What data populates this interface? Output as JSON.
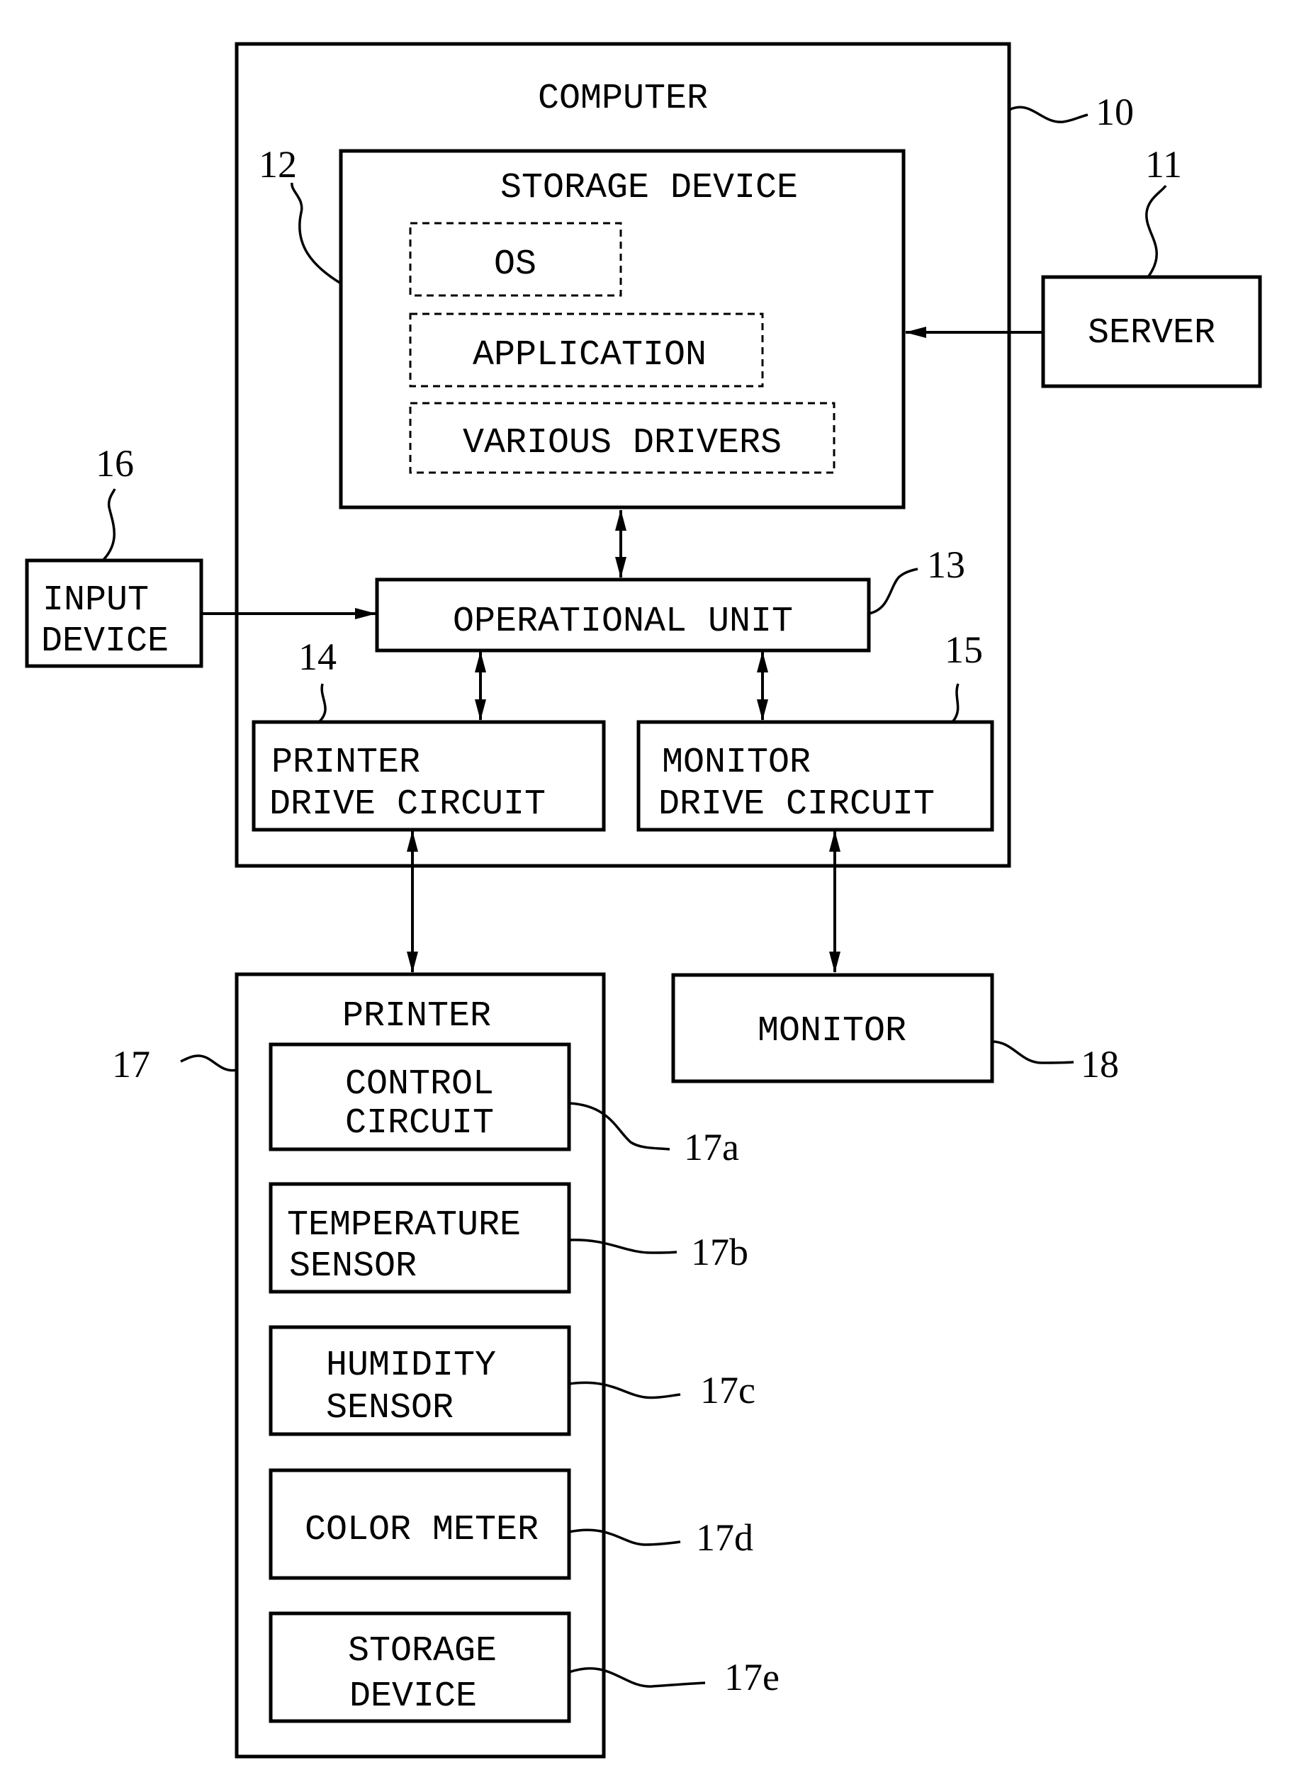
{
  "figure": {
    "computer": {
      "label": "COMPUTER",
      "ref": "10"
    },
    "server": {
      "label": "SERVER",
      "ref": "11"
    },
    "storage_device": {
      "label": "STORAGE DEVICE",
      "ref": "12",
      "contents": [
        "OS",
        "APPLICATION",
        "VARIOUS DRIVERS"
      ]
    },
    "operational_unit": {
      "label": "OPERATIONAL UNIT",
      "ref": "13"
    },
    "printer_drive_circuit": {
      "lines": [
        "PRINTER",
        "DRIVE CIRCUIT"
      ],
      "ref": "14"
    },
    "monitor_drive_circuit": {
      "lines": [
        "MONITOR",
        "DRIVE CIRCUIT"
      ],
      "ref": "15"
    },
    "input_device": {
      "lines": [
        "INPUT",
        "DEVICE"
      ],
      "ref": "16"
    },
    "printer": {
      "label": "PRINTER",
      "ref": "17",
      "components": [
        {
          "lines": [
            "CONTROL",
            "CIRCUIT"
          ],
          "ref": "17a"
        },
        {
          "lines": [
            "TEMPERATURE",
            "SENSOR"
          ],
          "ref": "17b"
        },
        {
          "lines": [
            "HUMIDITY",
            "SENSOR"
          ],
          "ref": "17c"
        },
        {
          "lines": [
            "COLOR METER"
          ],
          "ref": "17d"
        },
        {
          "lines": [
            "STORAGE",
            "DEVICE"
          ],
          "ref": "17e"
        }
      ]
    },
    "monitor": {
      "label": "MONITOR",
      "ref": "18"
    }
  }
}
